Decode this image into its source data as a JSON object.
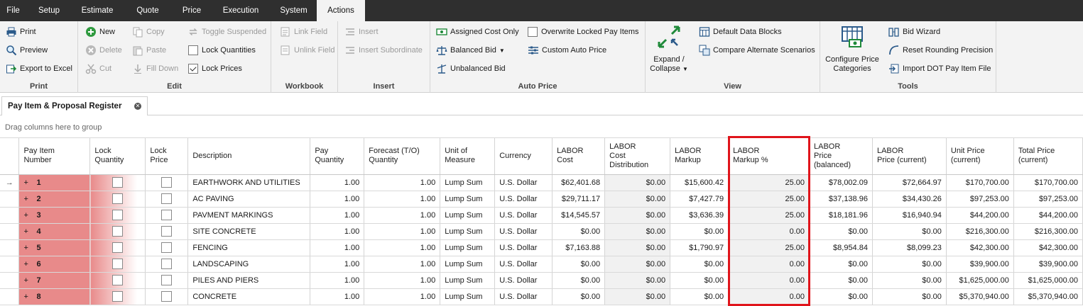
{
  "menu": {
    "tabs": [
      "File",
      "Setup",
      "Estimate",
      "Quote",
      "Price",
      "Execution",
      "System",
      "Actions"
    ],
    "active": "Actions"
  },
  "ribbon": {
    "print": {
      "label": "Print",
      "items": [
        "Print",
        "Preview",
        "Export to Excel"
      ]
    },
    "edit": {
      "label": "Edit",
      "new": "New",
      "delete": "Delete",
      "cut": "Cut",
      "copy": "Copy",
      "paste": "Paste",
      "fill_down": "Fill Down",
      "toggle_suspended": "Toggle Suspended",
      "lock_quantities": "Lock Quantities",
      "lock_quantities_checked": false,
      "lock_prices": "Lock Prices",
      "lock_prices_checked": true
    },
    "workbook": {
      "label": "Workbook",
      "link_field": "Link Field",
      "unlink_field": "Unlink Field"
    },
    "insert": {
      "label": "Insert",
      "insert": "Insert",
      "insert_subordinate": "Insert Subordinate"
    },
    "auto_price": {
      "label": "Auto Price",
      "assigned_cost_only": "Assigned Cost Only",
      "balanced_bid": "Balanced Bid",
      "unbalanced_bid": "Unbalanced Bid",
      "overwrite_locked": "Overwrite Locked Pay Items",
      "custom_auto_price": "Custom Auto Price"
    },
    "view": {
      "label": "View",
      "expand_collapse_1": "Expand /",
      "expand_collapse_2": "Collapse",
      "default_data_blocks": "Default Data Blocks",
      "compare_alternate": "Compare Alternate Scenarios"
    },
    "tools": {
      "label": "Tools",
      "configure_1": "Configure Price",
      "configure_2": "Categories",
      "bid_wizard": "Bid Wizard",
      "reset_rounding": "Reset Rounding Precision",
      "import_dot": "Import DOT Pay Item File"
    }
  },
  "document_tab": {
    "title": "Pay Item & Proposal Register"
  },
  "group_panel": {
    "hint": "Drag columns here to group"
  },
  "grid": {
    "columns": [
      [
        "Pay Item",
        "Number"
      ],
      [
        "Lock",
        "Quantity"
      ],
      [
        "Lock",
        "Price"
      ],
      [
        "Description"
      ],
      [
        "Pay",
        "Quantity"
      ],
      [
        "Forecast (T/O)",
        "Quantity"
      ],
      [
        "Unit of",
        "Measure"
      ],
      [
        "Currency"
      ],
      [
        "LABOR",
        "Cost"
      ],
      [
        "LABOR",
        "Cost",
        "Distribution"
      ],
      [
        "LABOR",
        "Markup"
      ],
      [
        "LABOR",
        "Markup %"
      ],
      [
        "LABOR",
        "Price",
        "(balanced)"
      ],
      [
        "LABOR",
        "Price (current)"
      ],
      [
        "Unit Price",
        "(current)"
      ],
      [
        "Total Price",
        "(current)"
      ]
    ],
    "rows": [
      {
        "num": "1",
        "desc": "EARTHWORK AND UTILITIES",
        "pay_qty": "1.00",
        "fc_qty": "1.00",
        "uom": "Lump Sum",
        "cur": "U.S. Dollar",
        "labor_cost": "$62,401.68",
        "labor_dist": "$0.00",
        "labor_markup": "$15,600.42",
        "labor_markup_pct": "25.00",
        "labor_price_bal": "$78,002.09",
        "labor_price_cur": "$72,664.97",
        "unit_price": "$170,700.00",
        "total_price": "$170,700.00"
      },
      {
        "num": "2",
        "desc": "AC PAVING",
        "pay_qty": "1.00",
        "fc_qty": "1.00",
        "uom": "Lump Sum",
        "cur": "U.S. Dollar",
        "labor_cost": "$29,711.17",
        "labor_dist": "$0.00",
        "labor_markup": "$7,427.79",
        "labor_markup_pct": "25.00",
        "labor_price_bal": "$37,138.96",
        "labor_price_cur": "$34,430.26",
        "unit_price": "$97,253.00",
        "total_price": "$97,253.00"
      },
      {
        "num": "3",
        "desc": "PAVMENT MARKINGS",
        "pay_qty": "1.00",
        "fc_qty": "1.00",
        "uom": "Lump Sum",
        "cur": "U.S. Dollar",
        "labor_cost": "$14,545.57",
        "labor_dist": "$0.00",
        "labor_markup": "$3,636.39",
        "labor_markup_pct": "25.00",
        "labor_price_bal": "$18,181.96",
        "labor_price_cur": "$16,940.94",
        "unit_price": "$44,200.00",
        "total_price": "$44,200.00"
      },
      {
        "num": "4",
        "desc": "SITE CONCRETE",
        "pay_qty": "1.00",
        "fc_qty": "1.00",
        "uom": "Lump Sum",
        "cur": "U.S. Dollar",
        "labor_cost": "$0.00",
        "labor_dist": "$0.00",
        "labor_markup": "$0.00",
        "labor_markup_pct": "0.00",
        "labor_price_bal": "$0.00",
        "labor_price_cur": "$0.00",
        "unit_price": "$216,300.00",
        "total_price": "$216,300.00"
      },
      {
        "num": "5",
        "desc": "FENCING",
        "pay_qty": "1.00",
        "fc_qty": "1.00",
        "uom": "Lump Sum",
        "cur": "U.S. Dollar",
        "labor_cost": "$7,163.88",
        "labor_dist": "$0.00",
        "labor_markup": "$1,790.97",
        "labor_markup_pct": "25.00",
        "labor_price_bal": "$8,954.84",
        "labor_price_cur": "$8,099.23",
        "unit_price": "$42,300.00",
        "total_price": "$42,300.00"
      },
      {
        "num": "6",
        "desc": "LANDSCAPING",
        "pay_qty": "1.00",
        "fc_qty": "1.00",
        "uom": "Lump Sum",
        "cur": "U.S. Dollar",
        "labor_cost": "$0.00",
        "labor_dist": "$0.00",
        "labor_markup": "$0.00",
        "labor_markup_pct": "0.00",
        "labor_price_bal": "$0.00",
        "labor_price_cur": "$0.00",
        "unit_price": "$39,900.00",
        "total_price": "$39,900.00"
      },
      {
        "num": "7",
        "desc": "PILES AND PIERS",
        "pay_qty": "1.00",
        "fc_qty": "1.00",
        "uom": "Lump Sum",
        "cur": "U.S. Dollar",
        "labor_cost": "$0.00",
        "labor_dist": "$0.00",
        "labor_markup": "$0.00",
        "labor_markup_pct": "0.00",
        "labor_price_bal": "$0.00",
        "labor_price_cur": "$0.00",
        "unit_price": "$1,625,000.00",
        "total_price": "$1,625,000.00"
      },
      {
        "num": "8",
        "desc": "CONCRETE",
        "pay_qty": "1.00",
        "fc_qty": "1.00",
        "uom": "Lump Sum",
        "cur": "U.S. Dollar",
        "labor_cost": "$0.00",
        "labor_dist": "$0.00",
        "labor_markup": "$0.00",
        "labor_markup_pct": "0.00",
        "labor_price_bal": "$0.00",
        "labor_price_cur": "$0.00",
        "unit_price": "$5,370,940.00",
        "total_price": "$5,370,940.00"
      }
    ],
    "current_row_indicator": "→",
    "expand_glyph": "+"
  },
  "colors": {
    "menubar": "#2f2f2f",
    "ribbon": "#f3f3f3",
    "pay_item_fill": "#e88a8a",
    "highlight_border": "#e0141b"
  },
  "highlight": {
    "column": "LABOR Markup %"
  }
}
